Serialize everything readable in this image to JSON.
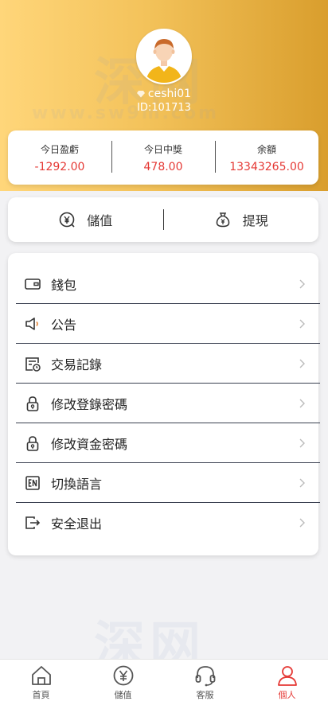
{
  "user": {
    "name": "ceshi01",
    "id_text": "ID:101713"
  },
  "stats": [
    {
      "label": "今日盈虧",
      "value": "-1292.00"
    },
    {
      "label": "今日中獎",
      "value": "478.00"
    },
    {
      "label": "余額",
      "value": "13343265.00"
    }
  ],
  "actions": {
    "deposit": "儲值",
    "withdraw": "提現"
  },
  "menu": [
    {
      "label": "錢包",
      "icon": "wallet-icon"
    },
    {
      "label": "公告",
      "icon": "megaphone-icon"
    },
    {
      "label": "交易記錄",
      "icon": "transaction-record-icon"
    },
    {
      "label": "修改登錄密碼",
      "icon": "lock-icon"
    },
    {
      "label": "修改資金密碼",
      "icon": "lock-icon"
    },
    {
      "label": "切換語言",
      "icon": "en-language-icon"
    },
    {
      "label": "安全退出",
      "icon": "logout-icon"
    }
  ],
  "tabs": [
    {
      "label": "首頁",
      "icon": "home-icon"
    },
    {
      "label": "儲值",
      "icon": "yen-coin-icon"
    },
    {
      "label": "客服",
      "icon": "headset-icon"
    },
    {
      "label": "個人",
      "icon": "person-icon",
      "active": true
    }
  ],
  "watermark": {
    "cn": "深网",
    "url": "www.sw9m.com"
  },
  "colors": {
    "accent": "#e53935",
    "header_start": "#ffd67a",
    "header_end": "#d99e2d"
  }
}
